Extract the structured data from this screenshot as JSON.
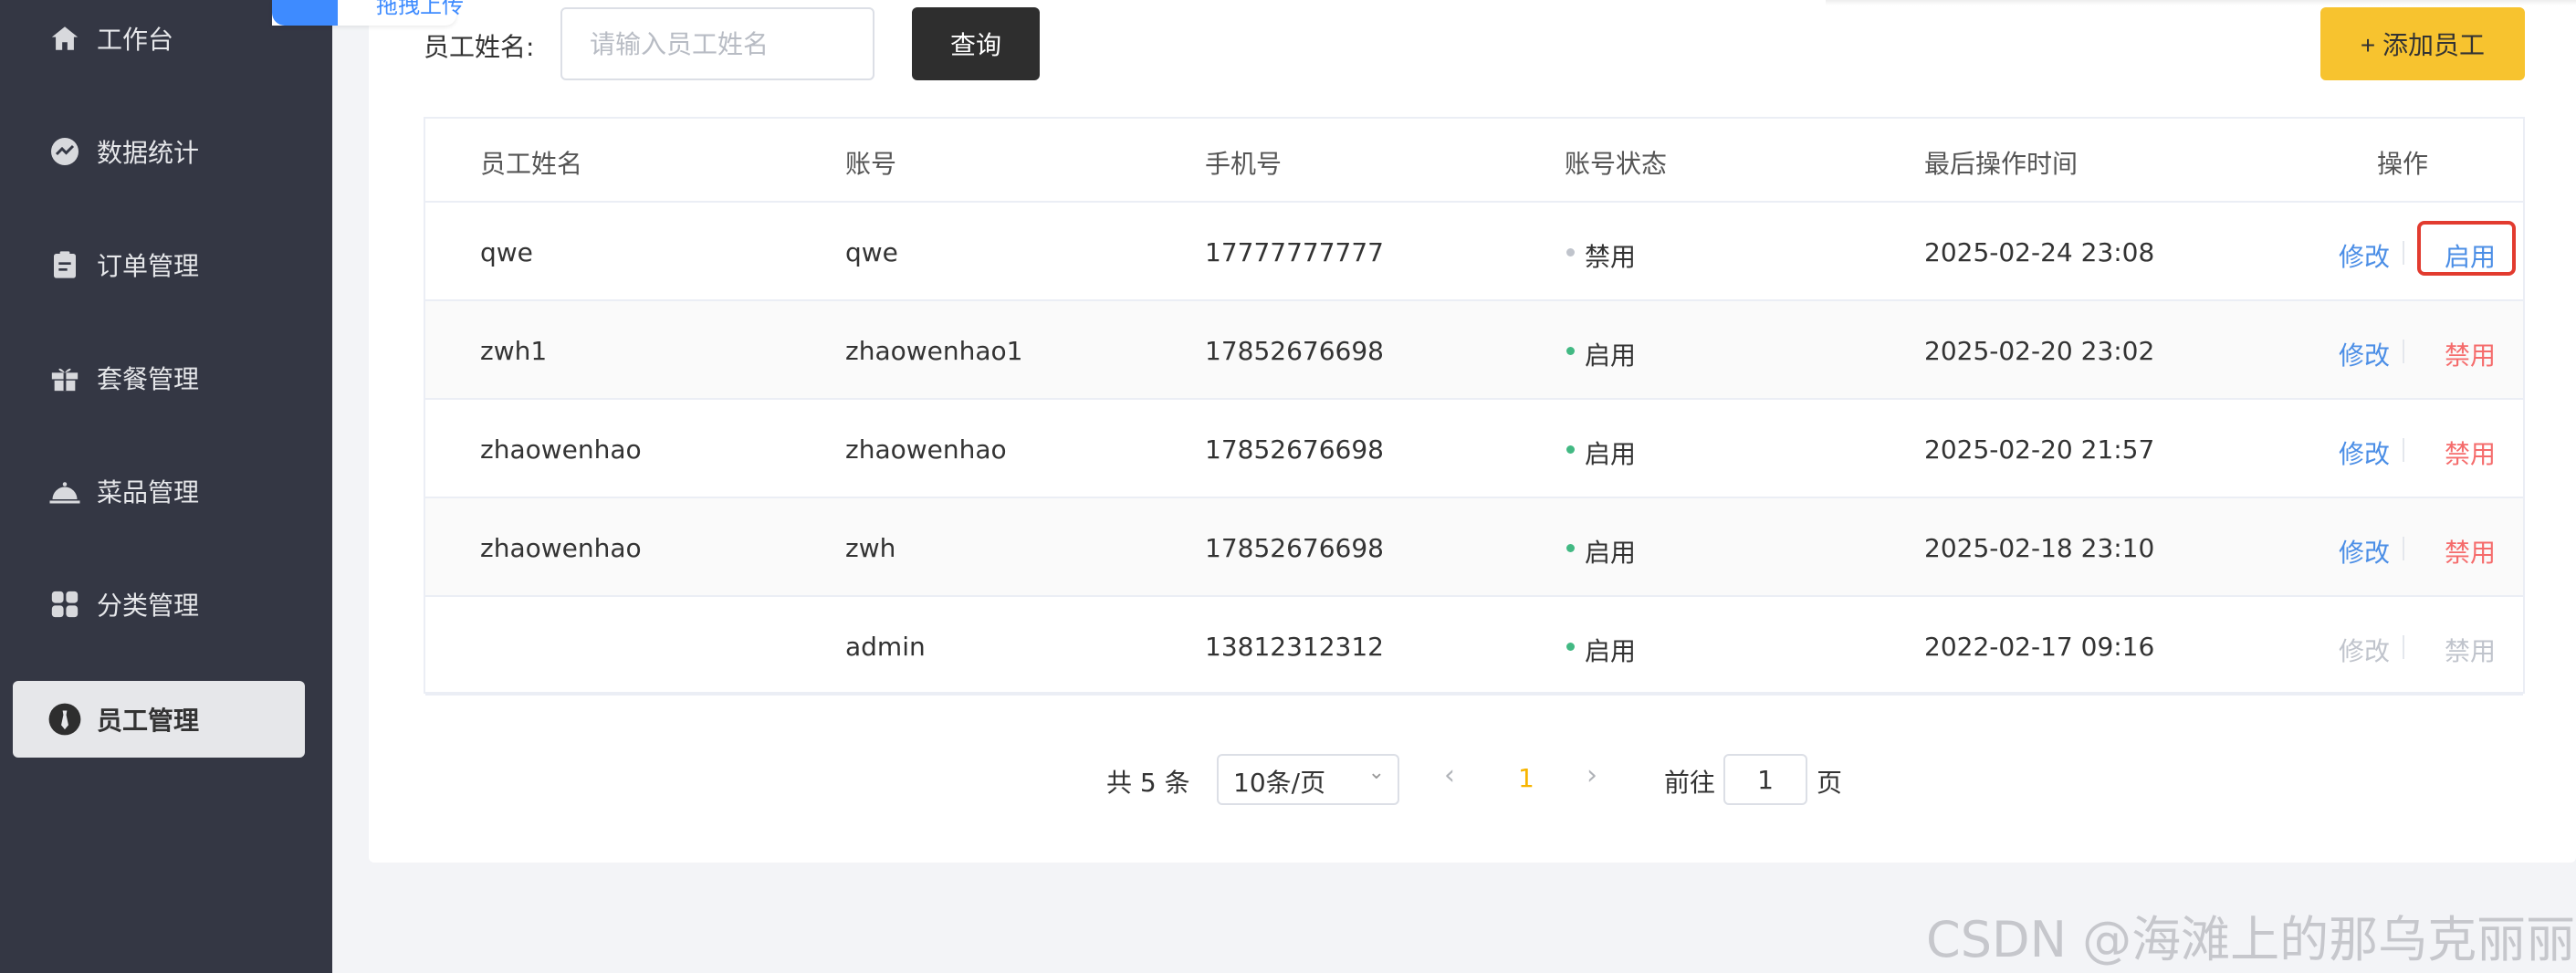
{
  "sidebar": {
    "items": [
      {
        "label": "工作台",
        "icon": "home-icon"
      },
      {
        "label": "数据统计",
        "icon": "chart-icon"
      },
      {
        "label": "订单管理",
        "icon": "clipboard-icon"
      },
      {
        "label": "套餐管理",
        "icon": "gift-icon"
      },
      {
        "label": "菜品管理",
        "icon": "dish-cover-icon"
      },
      {
        "label": "分类管理",
        "icon": "grid-icon"
      },
      {
        "label": "员工管理",
        "icon": "employee-icon",
        "active": true
      }
    ]
  },
  "upload_badge": {
    "text": "拖拽上传"
  },
  "search": {
    "label": "员工姓名:",
    "placeholder": "请输入员工姓名",
    "query_label": "查询"
  },
  "add_button": {
    "label": "+ 添加员工"
  },
  "table": {
    "headers": [
      "员工姓名",
      "账号",
      "手机号",
      "账号状态",
      "最后操作时间",
      "操作"
    ],
    "rows": [
      {
        "name": "qwe",
        "account": "qwe",
        "phone": "17777777777",
        "status": "禁用",
        "status_color": "#c0c4cc",
        "time": "2025-02-24 23:08",
        "edit": "修改",
        "toggle": "启用",
        "toggle_color": "#4b8ee6",
        "disabled": false
      },
      {
        "name": "zwh1",
        "account": "zhaowenhao1",
        "phone": "17852676698",
        "status": "启用",
        "status_color": "#42b983",
        "time": "2025-02-20 23:02",
        "edit": "修改",
        "toggle": "禁用",
        "toggle_color": "#f56c6c",
        "disabled": false
      },
      {
        "name": "zhaowenhao",
        "account": "zhaowenhao",
        "phone": "17852676698",
        "status": "启用",
        "status_color": "#42b983",
        "time": "2025-02-20 21:57",
        "edit": "修改",
        "toggle": "禁用",
        "toggle_color": "#f56c6c",
        "disabled": false
      },
      {
        "name": "zhaowenhao",
        "account": "zwh",
        "phone": "17852676698",
        "status": "启用",
        "status_color": "#42b983",
        "time": "2025-02-18 23:10",
        "edit": "修改",
        "toggle": "禁用",
        "toggle_color": "#f56c6c",
        "disabled": false
      },
      {
        "name": "",
        "account": "admin",
        "phone": "13812312312",
        "status": "启用",
        "status_color": "#42b983",
        "time": "2022-02-17 09:16",
        "edit": "修改",
        "toggle": "禁用",
        "toggle_color": "#c0c4cc",
        "disabled": true
      }
    ]
  },
  "pagination": {
    "total_text": "共 5 条",
    "page_size": "10条/页",
    "current_page": "1",
    "goto_label": "前往",
    "goto_value": "1",
    "page_suffix": "页"
  },
  "watermark": "CSDN @海滩上的那乌克丽丽",
  "colors": {
    "sidebar_bg": "#343744",
    "accent_yellow": "#f7c32f",
    "link_blue": "#4b8ee6",
    "danger_red": "#f56c6c",
    "highlight_red": "#e23b2f"
  }
}
